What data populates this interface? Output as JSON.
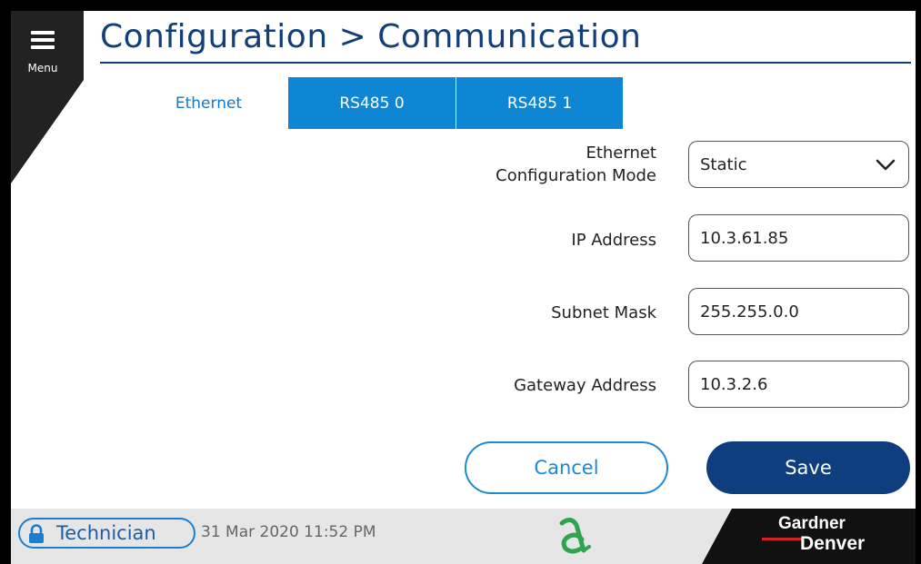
{
  "header": {
    "menu_label": "Menu",
    "title": "Configuration > Communication"
  },
  "tabs": [
    {
      "label": "Ethernet",
      "active": true
    },
    {
      "label": "RS485 0",
      "active": false
    },
    {
      "label": "RS485 1",
      "active": false
    }
  ],
  "form": {
    "mode_label_line1": "Ethernet",
    "mode_label_line2": "Configuration Mode",
    "mode_value": "Static",
    "ip_label": "IP Address",
    "ip_value": "10.3.61.85",
    "subnet_label": "Subnet Mask",
    "subnet_value": "255.255.0.0",
    "gateway_label": "Gateway Address",
    "gateway_value": "10.3.2.6"
  },
  "actions": {
    "cancel_label": "Cancel",
    "save_label": "Save"
  },
  "footer": {
    "user": "Technician",
    "datetime": "31 Mar 2020 11:52 PM",
    "brand_line1": "Gardner",
    "brand_line2": "Denver"
  },
  "icons": {
    "menu": "hamburger-icon",
    "dropdown": "chevron-down-icon",
    "lock": "lock-icon",
    "status": "status-logo-icon"
  },
  "colors": {
    "title": "#123f7a",
    "tab_blue": "#0e86d4",
    "save": "#0f3e7f",
    "accent": "#1a8ad6",
    "status_logo": "#2ea44f",
    "brand_red": "#d1232a"
  }
}
